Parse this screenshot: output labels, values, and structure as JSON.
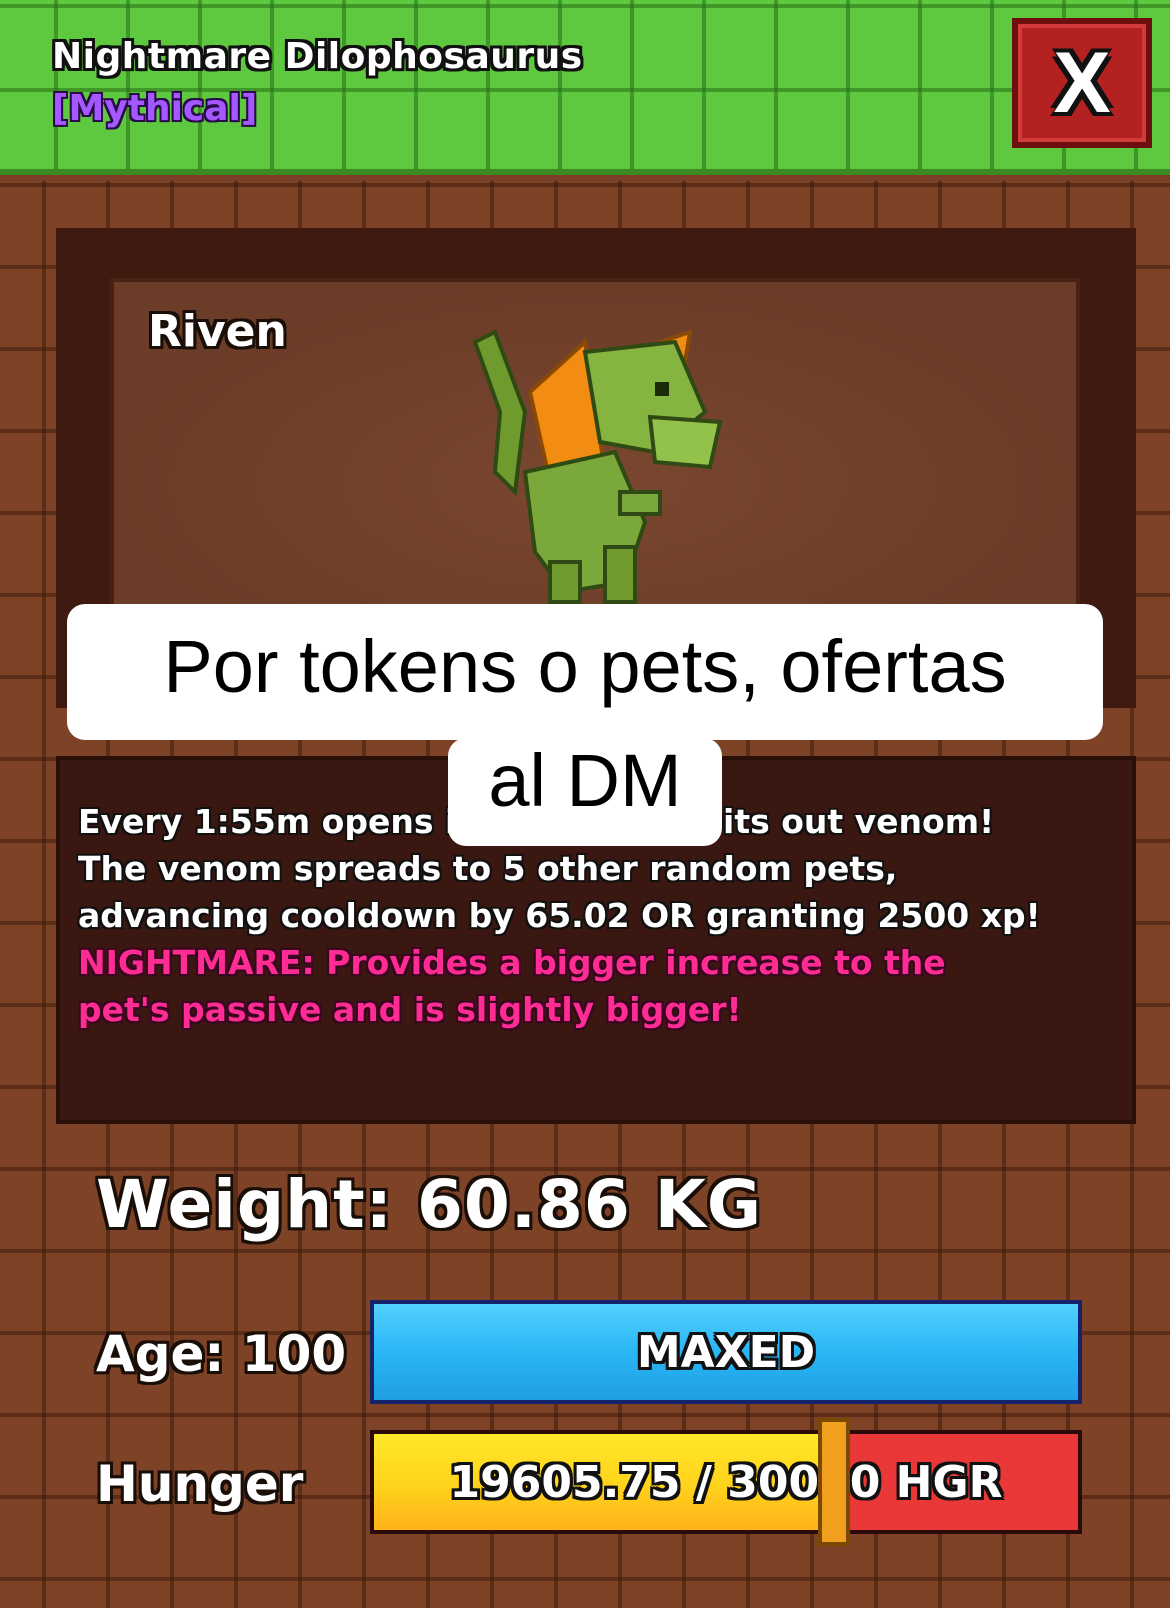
{
  "header": {
    "title": "Nightmare Dilophosaurus",
    "rarity": "[Mythical]",
    "close_label": "X"
  },
  "pet": {
    "name": "Riven",
    "art_icon": "green-dilophosaurus-sprite"
  },
  "description": {
    "lines": [
      "Every 1:55m opens its frills and spits out venom!",
      "The venom spreads to 5 other random pets,",
      "advancing cooldown by 65.02 OR granting 2500 xp!"
    ],
    "nightmare_lines": [
      "NIGHTMARE: Provides a bigger increase to the",
      "pet's passive and is slightly bigger!"
    ]
  },
  "stats": {
    "weight_label": "Weight: 60.86 KG",
    "age_label": "Age: 100",
    "age_bar_text": "MAXED",
    "hunger_label": "Hunger",
    "hunger_bar_text": "19605.75 / 30000 HGR",
    "hunger_current": 19605.75,
    "hunger_max": 30000
  },
  "caption": {
    "line1": "Por tokens o pets, ofertas",
    "line2": "al DM"
  },
  "colors": {
    "header_green": "#5ec83f",
    "rarity_purple": "#a458ff",
    "nightmare_pink": "#ff2d93",
    "close_red": "#b32121",
    "age_bar_blue": "#2ab6f5",
    "hunger_yellow": "#ffd21c",
    "hunger_red": "#ea3838",
    "wood_brown": "#7e4326"
  }
}
